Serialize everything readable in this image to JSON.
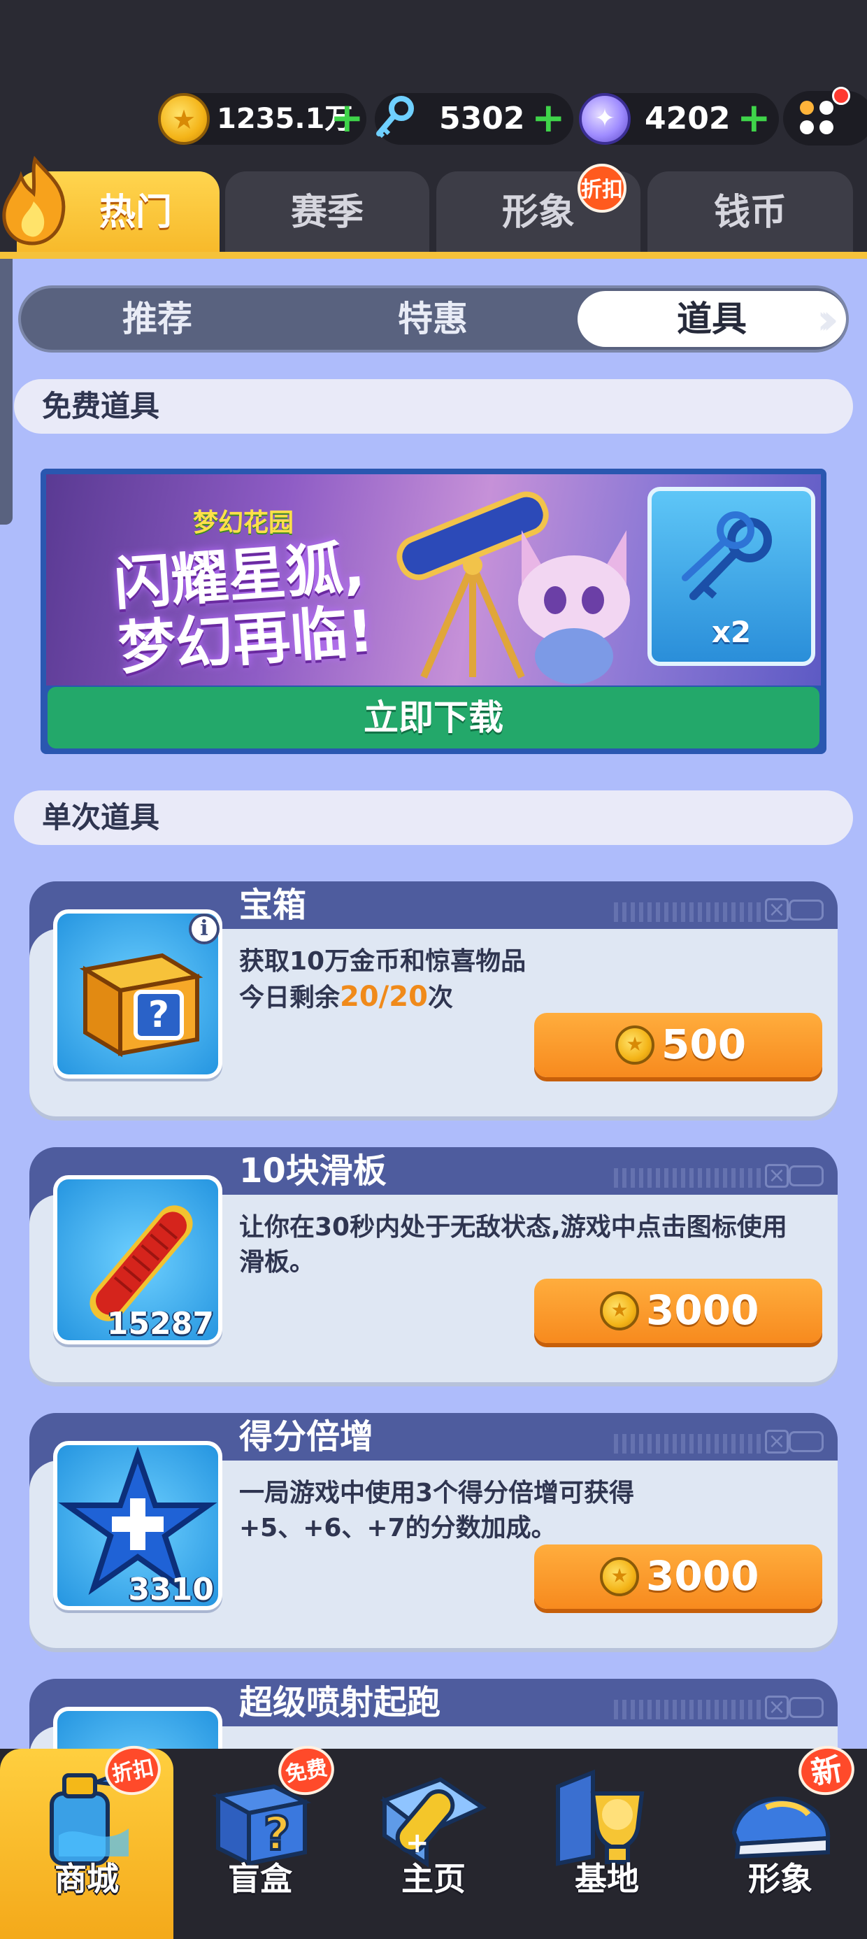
{
  "currency": {
    "coins": "1235.1万",
    "keys": "5302",
    "gems": "4202",
    "plus": "+"
  },
  "main_tabs": [
    {
      "label": "热门",
      "active": true
    },
    {
      "label": "赛季",
      "active": false
    },
    {
      "label": "形象",
      "active": false,
      "badge": "折扣"
    },
    {
      "label": "钱币",
      "active": false
    }
  ],
  "sub_tabs": [
    {
      "label": "推荐",
      "active": false
    },
    {
      "label": "特惠",
      "active": false
    },
    {
      "label": "道具",
      "active": true
    }
  ],
  "free_section": {
    "header": "免费道具",
    "banner": {
      "logo": "梦幻花园",
      "title": "闪耀星狐,\n梦幻再临!",
      "reward_label": "x2",
      "button": "立即下载"
    }
  },
  "single_section": {
    "header": "单次道具",
    "items": [
      {
        "title": "宝箱",
        "desc_line1": "获取10万金币和惊喜物品",
        "desc_line2_prefix": "今日剩余",
        "desc_line2_highlight": "20/20",
        "desc_line2_suffix": "次",
        "count": "",
        "price": "500",
        "icon": "mystery-chest-icon"
      },
      {
        "title": "10块滑板",
        "desc": "让你在30秒内处于无敌状态,游戏中点击图标使用滑板。",
        "count": "15287",
        "price": "3000",
        "icon": "hoverboard-icon"
      },
      {
        "title": "得分倍增",
        "desc": "一局游戏中使用3个得分倍增可获得+5、+6、+7的分数加成。",
        "count": "3310",
        "price": "3000",
        "icon": "star-multiplier-icon"
      },
      {
        "title": "超级喷射起跑",
        "desc": "",
        "count": "",
        "price": "",
        "icon": "jetpack-icon"
      }
    ]
  },
  "bottom_nav": [
    {
      "label": "商城",
      "active": true,
      "badge": "折扣"
    },
    {
      "label": "盲盒",
      "active": false,
      "badge": "免费"
    },
    {
      "label": "主页",
      "active": false,
      "badge": ""
    },
    {
      "label": "基地",
      "active": false,
      "badge": ""
    },
    {
      "label": "形象",
      "active": false,
      "badge": "新"
    }
  ],
  "colors": {
    "accent_orange": "#f78a1e",
    "active_tab_yellow": "#ffd54f",
    "content_bg": "#aebcfb",
    "download_green": "#23a86a"
  }
}
